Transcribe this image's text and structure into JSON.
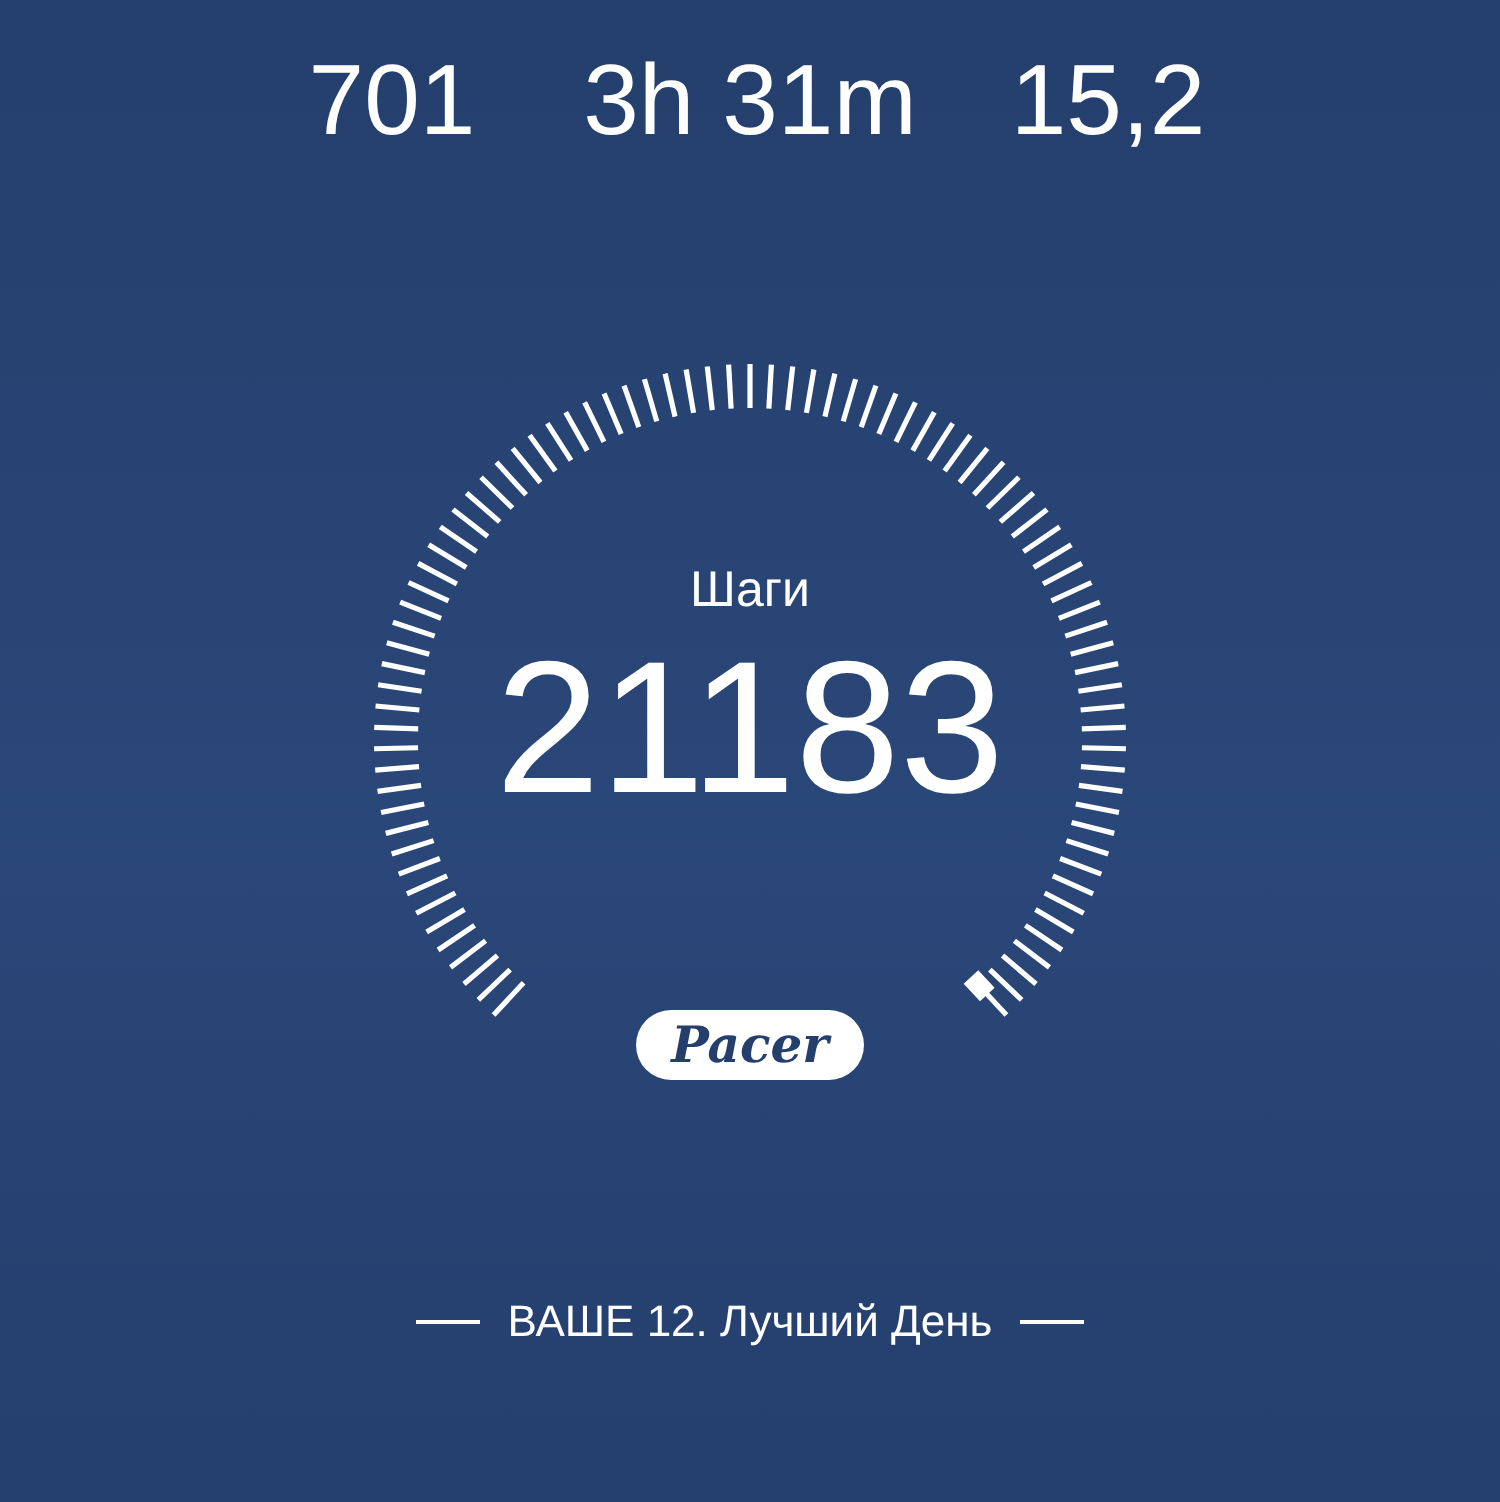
{
  "stats": [
    {
      "value": "701"
    },
    {
      "value": "3h 31m"
    },
    {
      "value": "15,2"
    }
  ],
  "steps": {
    "label": "Шаги",
    "value": "21183"
  },
  "badge": {
    "text": "Pacer"
  },
  "best_day": "ВАШЕ 12. Лучший День"
}
